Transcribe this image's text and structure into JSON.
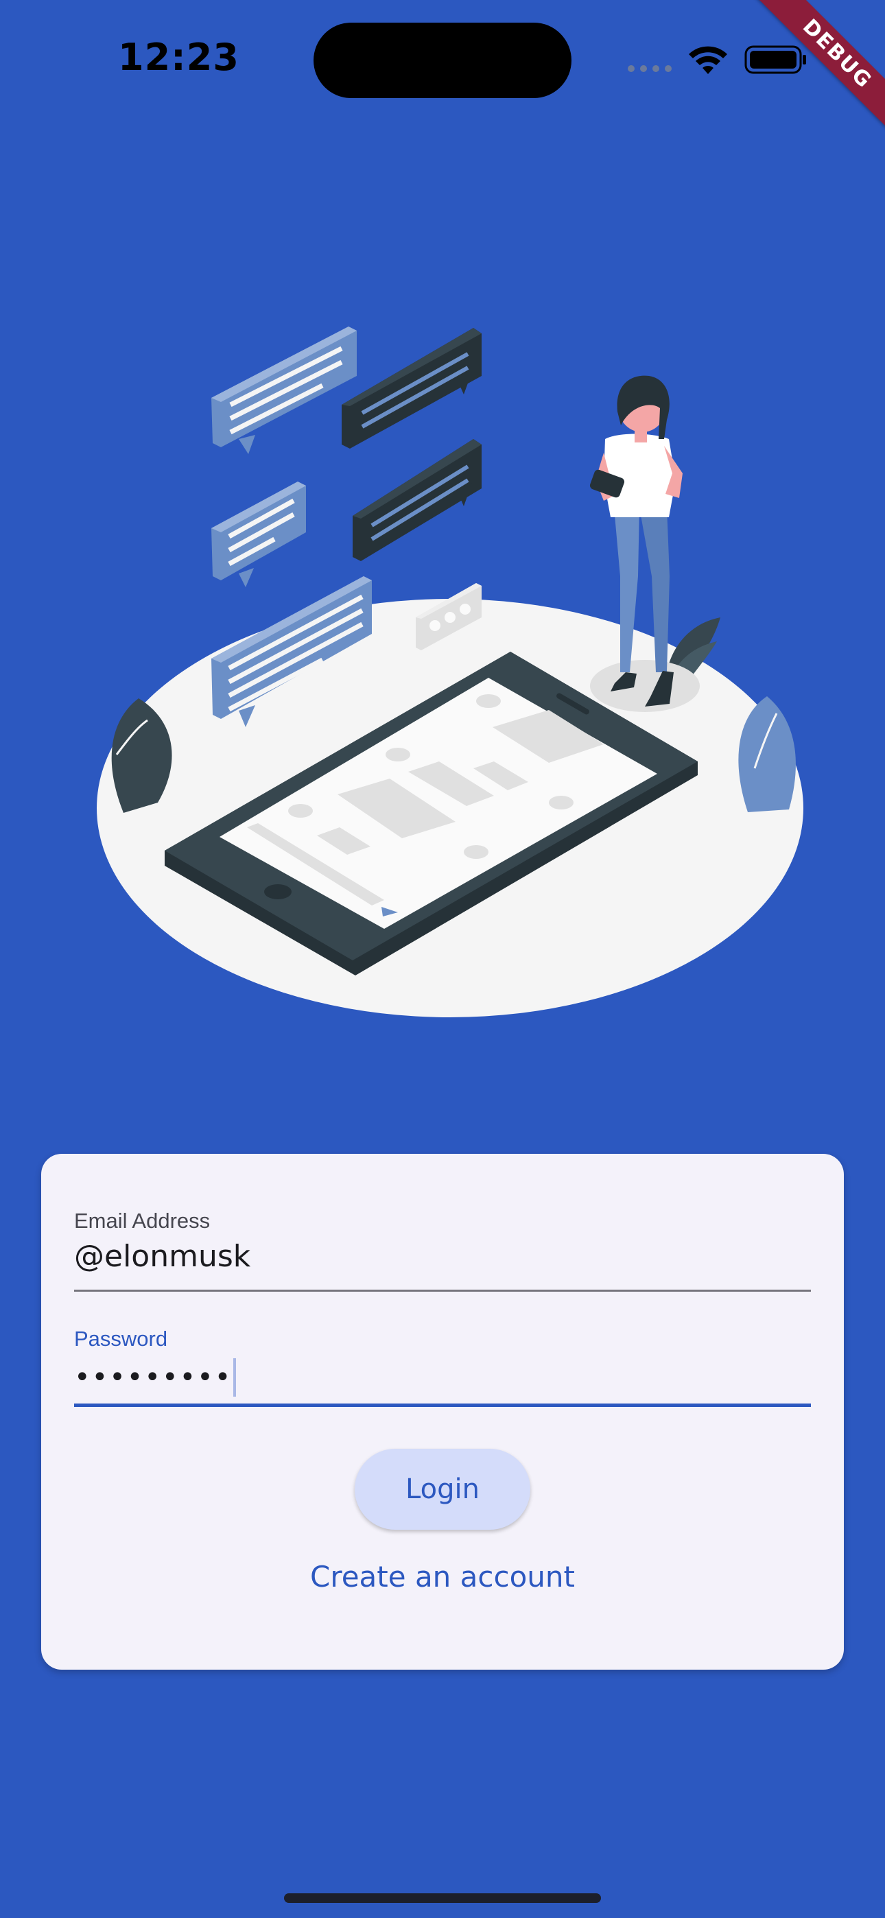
{
  "status_bar": {
    "time": "12:23",
    "debug_banner": "DEBUG",
    "icons": [
      "cellular-signal-icon",
      "wifi-icon",
      "battery-icon"
    ]
  },
  "illustration": {
    "name": "chat-messaging-illustration",
    "colors": {
      "platform": "#f5f5f5",
      "dark": "#37474f",
      "accent": "#6b8fc7",
      "light_accent": "#9bb4dc"
    }
  },
  "login_form": {
    "email": {
      "label": "Email Address",
      "value": "@elonmusk"
    },
    "password": {
      "label": "Password",
      "value": "•••••••••"
    },
    "login_label": "Login",
    "create_account_label": "Create an account"
  },
  "colors": {
    "background": "#2c58c0",
    "card": "#f4f2fa",
    "primary": "#2c58c0",
    "button_fill": "#d4dcfa"
  }
}
